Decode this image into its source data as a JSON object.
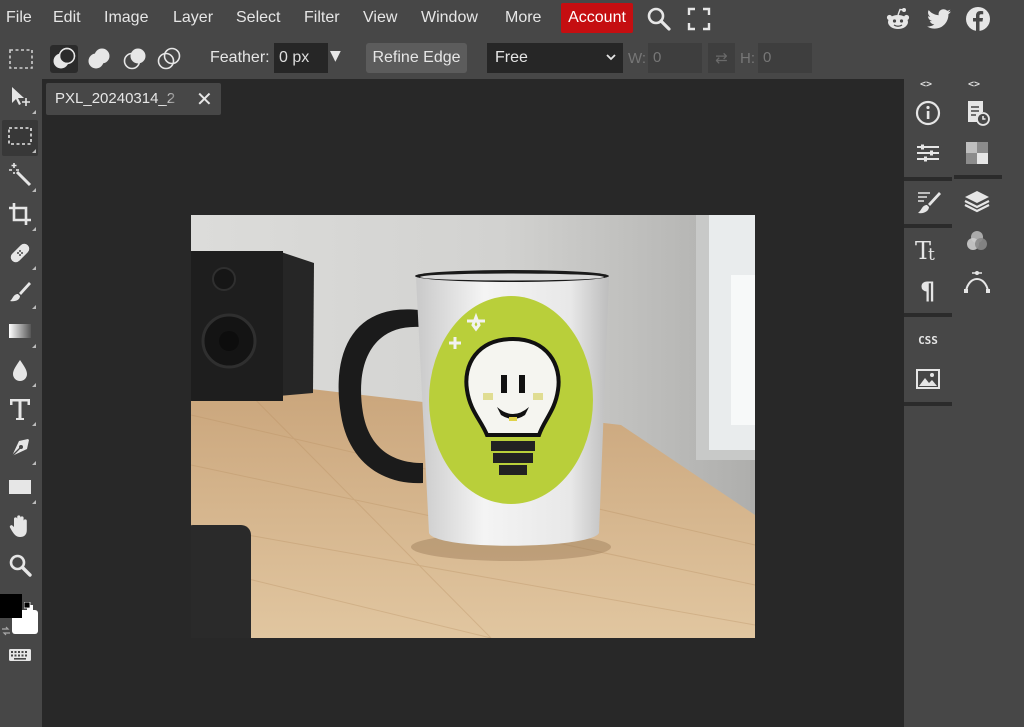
{
  "menu": {
    "file": "File",
    "edit": "Edit",
    "image": "Image",
    "layer": "Layer",
    "select": "Select",
    "filter": "Filter",
    "view": "View",
    "window": "Window",
    "more": "More",
    "account": "Account"
  },
  "menu_icons": {
    "search": "search-icon",
    "fullscreen": "fullscreen-icon",
    "reddit": "reddit-icon",
    "twitter": "twitter-icon",
    "facebook": "facebook-icon"
  },
  "options": {
    "feather_label": "Feather:",
    "feather_value": "0 px",
    "refine_edge": "Refine Edge",
    "style_value": "Free",
    "w_label": "W:",
    "w_value": "0",
    "h_label": "H:",
    "h_value": "0"
  },
  "tools": [
    "move",
    "marquee-select",
    "magic-wand",
    "crop",
    "healing-brush",
    "brush",
    "gradient",
    "blur",
    "text",
    "pen",
    "shape",
    "hand",
    "zoom"
  ],
  "colors": {
    "foreground": "#000000",
    "background": "#ffffff",
    "accent": "#c50e11",
    "workspace": "#282828",
    "chrome": "#474747"
  },
  "document": {
    "tab_name": "PXL_20240314_2",
    "close": "✕"
  },
  "right_panel": {
    "toggle_left": "<>",
    "toggle_right": "<>",
    "css_label": "CSS",
    "type_label": "Tt"
  }
}
